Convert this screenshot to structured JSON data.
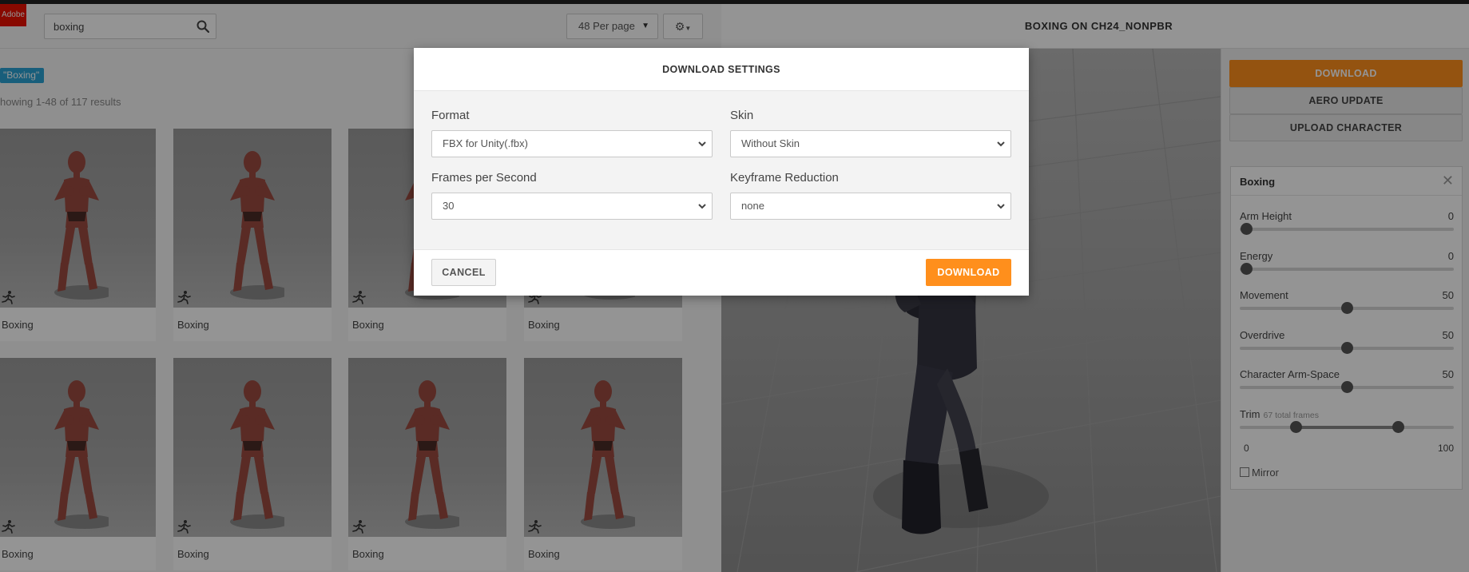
{
  "brand": {
    "logo_text": "Adobe"
  },
  "search": {
    "value": "boxing"
  },
  "toolbar": {
    "per_page": "48 Per page"
  },
  "filter_tag": "\"Boxing\"",
  "results_text": "howing 1-48 of 117 results",
  "cards": [
    {
      "label": "Boxing"
    },
    {
      "label": "Boxing"
    },
    {
      "label": "Boxing"
    },
    {
      "label": "Boxing"
    },
    {
      "label": "Boxing"
    },
    {
      "label": "Boxing"
    },
    {
      "label": "Boxing"
    },
    {
      "label": "Boxing"
    }
  ],
  "viewer": {
    "title": "BOXING ON CH24_NONPBR"
  },
  "right_panel": {
    "download_label": "DOWNLOAD",
    "aero_update_label": "AERO UPDATE",
    "upload_label": "UPLOAD CHARACTER"
  },
  "settings": {
    "title": "Boxing",
    "params": [
      {
        "name": "Arm Height",
        "value": "0",
        "fraction": 0.0
      },
      {
        "name": "Energy",
        "value": "0",
        "fraction": 0.0
      },
      {
        "name": "Movement",
        "value": "50",
        "fraction": 0.5
      },
      {
        "name": "Overdrive",
        "value": "50",
        "fraction": 0.5
      },
      {
        "name": "Character Arm-Space",
        "value": "50",
        "fraction": 0.5
      }
    ],
    "trim": {
      "name": "Trim",
      "sub": "67 total frames",
      "min": "0",
      "max": "100",
      "start_fraction": 0.26,
      "end_fraction": 0.74
    },
    "mirror_label": "Mirror"
  },
  "modal": {
    "title": "DOWNLOAD SETTINGS",
    "format_label": "Format",
    "format_value": "FBX for Unity(.fbx)",
    "skin_label": "Skin",
    "skin_value": "Without Skin",
    "fps_label": "Frames per Second",
    "fps_value": "30",
    "keyframe_label": "Keyframe Reduction",
    "keyframe_value": "none",
    "cancel_label": "CANCEL",
    "download_label": "DOWNLOAD"
  },
  "colors": {
    "accent": "#ff8f1c",
    "tag": "#2aa3d4",
    "figure": "#9c4a40"
  }
}
